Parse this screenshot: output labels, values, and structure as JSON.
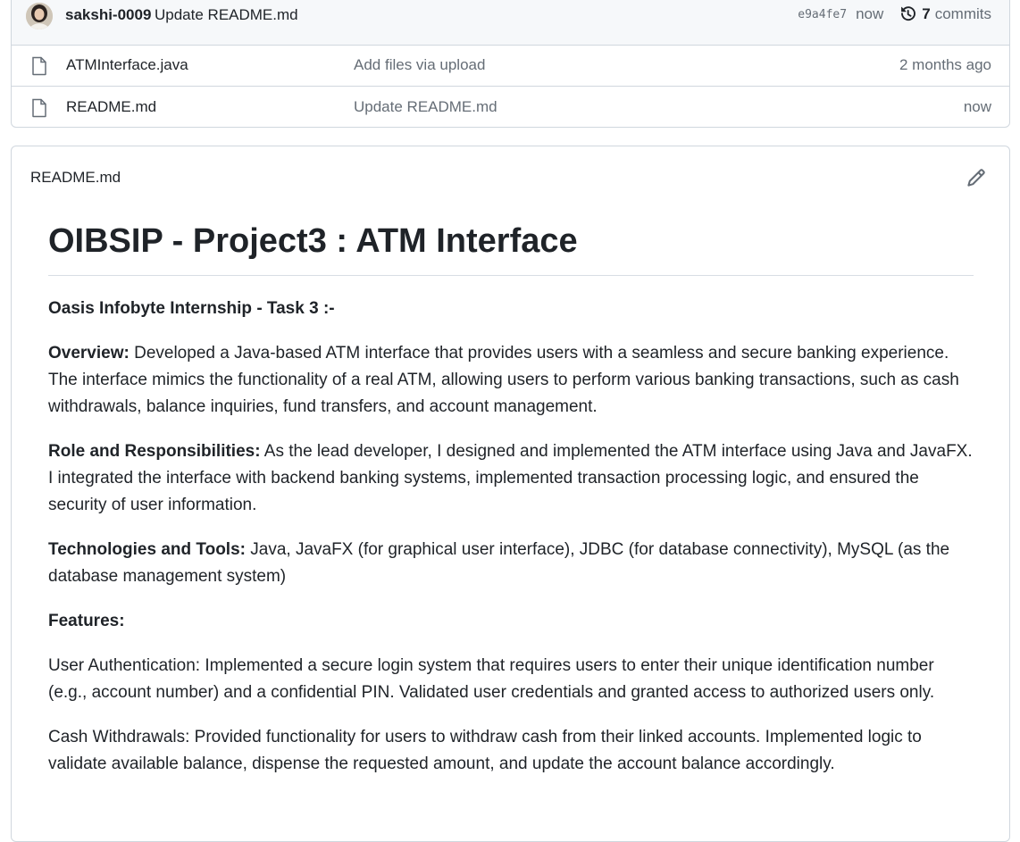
{
  "latest_commit": {
    "author": "sakshi-0009",
    "message": "Update README.md",
    "sha": "e9a4fe7",
    "time": "now",
    "commit_count": "7",
    "commits_label": "commits"
  },
  "files": [
    {
      "name": "ATMInterface.java",
      "commit_message": "Add files via upload",
      "time": "2 months ago",
      "icon": "file-icon"
    },
    {
      "name": "README.md",
      "commit_message": "Update README.md",
      "time": "now",
      "icon": "file-icon"
    }
  ],
  "readme": {
    "filename": "README.md",
    "heading": "OIBSIP - Project3 : ATM Interface",
    "subtitle": "Oasis Infobyte Internship - Task 3 :-",
    "overview_label": "Overview:",
    "overview_text": " Developed a Java-based ATM interface that provides users with a seamless and secure banking experience. The interface mimics the functionality of a real ATM, allowing users to perform various banking transactions, such as cash withdrawals, balance inquiries, fund transfers, and account management.",
    "role_label": "Role and Responsibilities:",
    "role_text": " As the lead developer, I designed and implemented the ATM interface using Java and JavaFX. I integrated the interface with backend banking systems, implemented transaction processing logic, and ensured the security of user information.",
    "tech_label": "Technologies and Tools:",
    "tech_text": " Java, JavaFX (for graphical user interface), JDBC (for database connectivity), MySQL (as the database management system)",
    "features_label": "Features:",
    "feature_auth": "User Authentication: Implemented a secure login system that requires users to enter their unique identification number (e.g., account number) and a confidential PIN. Validated user credentials and granted access to authorized users only.",
    "feature_cash": "Cash Withdrawals: Provided functionality for users to withdraw cash from their linked accounts. Implemented logic to validate available balance, dispense the requested amount, and update the account balance accordingly."
  },
  "colors": {
    "text": "#1f2328",
    "muted": "#656d76",
    "border": "#d0d7de",
    "header_bg": "#f6f8fa"
  }
}
